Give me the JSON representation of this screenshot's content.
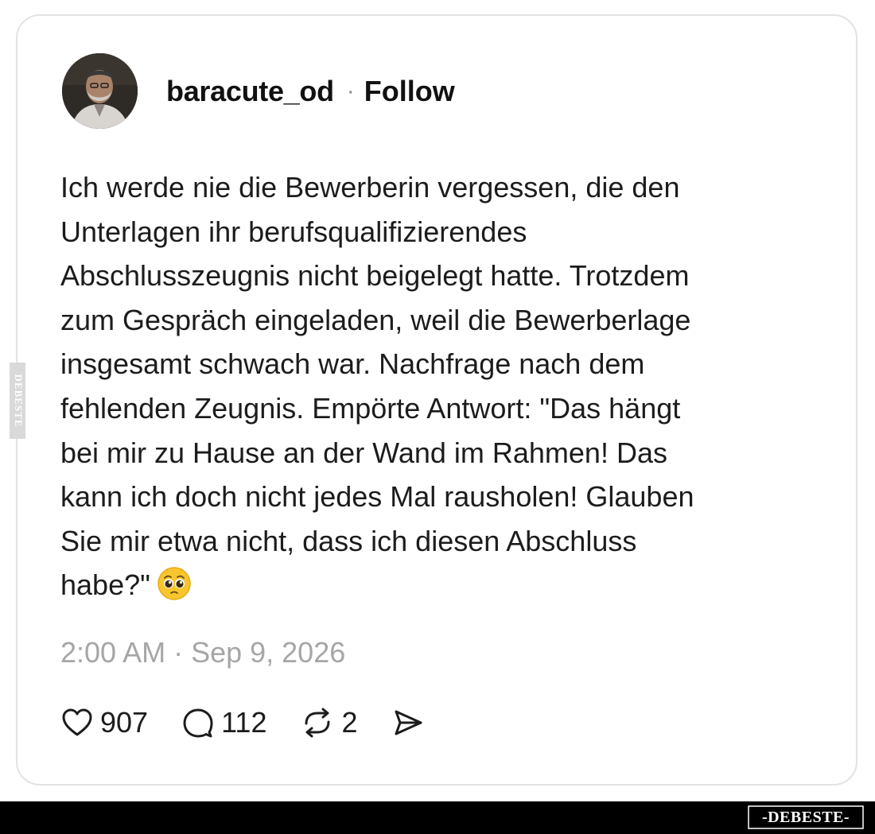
{
  "post": {
    "author": "baracute_od",
    "separator": "·",
    "follow_label": "Follow",
    "text": "Ich werde nie die Bewerberin vergessen, die den\nUnterlagen ihr berufsqualifizierendes\nAbschlusszeugnis nicht beigelegt hatte. Trotzdem\nzum Gespräch eingeladen, weil die Bewerberlage\ninsgesamt schwach war. Nachfrage nach dem\nfehlenden Zeugnis. Empörte Antwort: \"Das hängt\nbei mir zu Hause an der Wand im Rahmen! Das\nkann ich doch nicht jedes Mal rausholen! Glauben\nSie mir etwa nicht, dass ich diesen Abschluss\nhabe?\"",
    "emoji": "pleading-face-emoji",
    "timestamp": "2:00 AM · Sep 9, 2026"
  },
  "actions": {
    "likes": "907",
    "comments": "112",
    "reposts": "2",
    "icons": [
      "heart-icon",
      "comment-icon",
      "repost-icon",
      "share-icon"
    ]
  },
  "watermark": {
    "side_text": "DEBESTE",
    "footer_text": "-DEBESTE-"
  },
  "colors": {
    "card_border": "#e3e3e3",
    "timestamp": "#a6a6a6",
    "footer_bar": "#000000"
  }
}
